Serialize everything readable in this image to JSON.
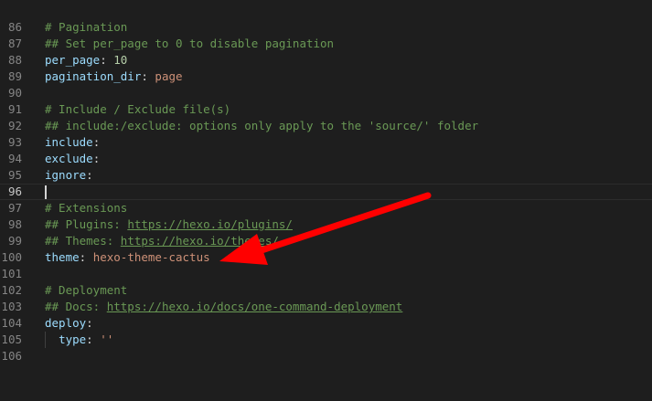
{
  "editor": {
    "lines": [
      {
        "n": "86",
        "parts": [
          {
            "t": "# Pagination",
            "c": "comment"
          }
        ]
      },
      {
        "n": "87",
        "parts": [
          {
            "t": "## Set per_page to 0 to disable pagination",
            "c": "comment"
          }
        ]
      },
      {
        "n": "88",
        "parts": [
          {
            "t": "per_page",
            "c": "key"
          },
          {
            "t": ": ",
            "c": "punct"
          },
          {
            "t": "10",
            "c": "num"
          }
        ]
      },
      {
        "n": "89",
        "parts": [
          {
            "t": "pagination_dir",
            "c": "key"
          },
          {
            "t": ": ",
            "c": "punct"
          },
          {
            "t": "page",
            "c": "str"
          }
        ]
      },
      {
        "n": "90",
        "parts": []
      },
      {
        "n": "91",
        "parts": [
          {
            "t": "# Include / Exclude file(s)",
            "c": "comment"
          }
        ]
      },
      {
        "n": "92",
        "parts": [
          {
            "t": "## include:/exclude: options only apply to the 'source/' folder",
            "c": "comment"
          }
        ]
      },
      {
        "n": "93",
        "parts": [
          {
            "t": "include",
            "c": "key"
          },
          {
            "t": ":",
            "c": "punct"
          }
        ]
      },
      {
        "n": "94",
        "parts": [
          {
            "t": "exclude",
            "c": "key"
          },
          {
            "t": ":",
            "c": "punct"
          }
        ]
      },
      {
        "n": "95",
        "parts": [
          {
            "t": "ignore",
            "c": "key"
          },
          {
            "t": ":",
            "c": "punct"
          }
        ]
      },
      {
        "n": "96",
        "parts": [],
        "current": true
      },
      {
        "n": "97",
        "parts": [
          {
            "t": "# Extensions",
            "c": "comment"
          }
        ]
      },
      {
        "n": "98",
        "parts": [
          {
            "t": "## Plugins: ",
            "c": "comment"
          },
          {
            "t": "https://hexo.io/plugins/",
            "c": "link"
          }
        ]
      },
      {
        "n": "99",
        "parts": [
          {
            "t": "## Themes: ",
            "c": "comment"
          },
          {
            "t": "https://hexo.io/themes/",
            "c": "link"
          }
        ]
      },
      {
        "n": "100",
        "parts": [
          {
            "t": "theme",
            "c": "key"
          },
          {
            "t": ": ",
            "c": "punct"
          },
          {
            "t": "hexo-theme-cactus",
            "c": "str"
          }
        ]
      },
      {
        "n": "101",
        "parts": []
      },
      {
        "n": "102",
        "parts": [
          {
            "t": "# Deployment",
            "c": "comment"
          }
        ]
      },
      {
        "n": "103",
        "parts": [
          {
            "t": "## Docs: ",
            "c": "comment"
          },
          {
            "t": "https://hexo.io/docs/one-command-deployment",
            "c": "link"
          }
        ]
      },
      {
        "n": "104",
        "parts": [
          {
            "t": "deploy",
            "c": "key"
          },
          {
            "t": ":",
            "c": "punct"
          }
        ]
      },
      {
        "n": "105",
        "parts": [
          {
            "t": "  ",
            "c": "punct"
          },
          {
            "t": "type",
            "c": "key"
          },
          {
            "t": ": ",
            "c": "punct"
          },
          {
            "t": "''",
            "c": "str"
          }
        ],
        "indent": true
      },
      {
        "n": "106",
        "parts": []
      }
    ]
  },
  "annotation": {
    "icon": "red-arrow-icon",
    "color": "#ff0000"
  }
}
